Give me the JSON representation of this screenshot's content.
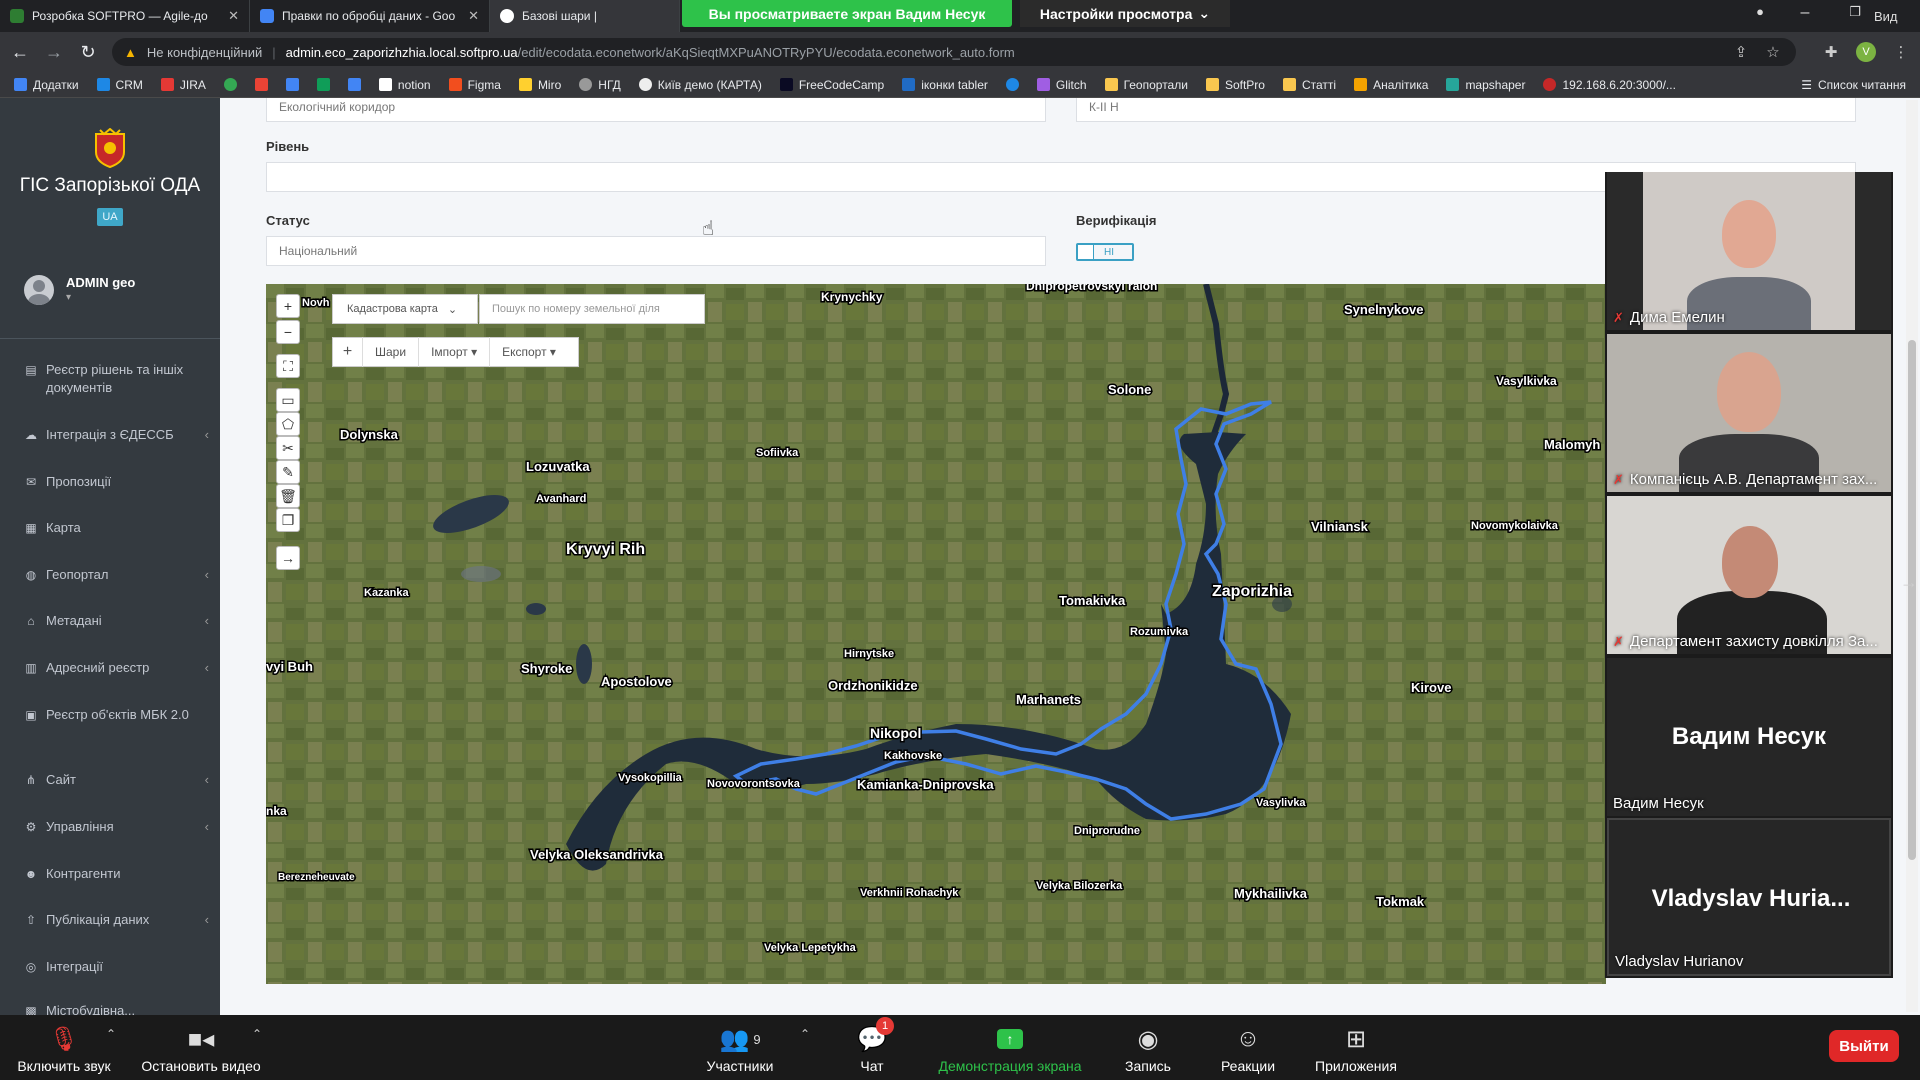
{
  "browser": {
    "tabs": [
      {
        "title": "Розробка SOFTPRO — Agile-до",
        "active": false
      },
      {
        "title": "Правки по обробці даних - Goo",
        "active": false
      },
      {
        "title": "Базові шари |",
        "active": true
      }
    ],
    "url_warning": "Не конфіденційний",
    "url_host": "admin.eco_zaporizhzhia.local.softpro.ua",
    "url_path": "/edit/ecodata.econetwork/aKqSieqtMXPuANOTRyPYU/ecodata.econetwork_auto.form",
    "window_corner_text": "Вид",
    "bookmarks": [
      "Додатки",
      "CRM",
      "JIRA",
      "notion",
      "Figma",
      "Miro",
      "НГД",
      "Київ демо (КАРТА)",
      "FreeCodeCamp",
      "іконки tabler",
      "Glitch",
      "Геопортали",
      "SoftPro",
      "Статті",
      "Аналітика",
      "mapshaper",
      "192.168.6.20:3000/..."
    ],
    "reading_list": "Список читання"
  },
  "zoom_share": {
    "banner": "Вы просматриваете экран Вадим Несук",
    "view_options": "Настройки просмотра"
  },
  "sidebar": {
    "brand": "ГІС Запорізької ОДА",
    "lang": "UA",
    "user": "ADMIN geo",
    "items": [
      {
        "label": "Реєстр рішень та іншіх документів",
        "icon": "file-icon",
        "chevron": false
      },
      {
        "label": "Інтеграція з ЄДЕССБ",
        "icon": "database-icon",
        "chevron": true
      },
      {
        "label": "Пропозиції",
        "icon": "mail-icon",
        "chevron": false
      },
      {
        "label": "Карта",
        "icon": "map-icon",
        "chevron": false
      },
      {
        "label": "Геопортал",
        "icon": "globe-icon",
        "chevron": true
      },
      {
        "label": "Метадані",
        "icon": "tag-icon",
        "chevron": true
      },
      {
        "label": "Адресний реєстр",
        "icon": "book-icon",
        "chevron": true
      },
      {
        "label": "Реєстр об'єктів МБК 2.0",
        "icon": "grid-icon",
        "chevron": false
      },
      {
        "label": "Сайт",
        "icon": "sitemap-icon",
        "chevron": true
      },
      {
        "label": "Управління",
        "icon": "settings-icon",
        "chevron": true
      },
      {
        "label": "Контрагенти",
        "icon": "users-icon",
        "chevron": false
      },
      {
        "label": "Публікація даних",
        "icon": "upload-icon",
        "chevron": true
      },
      {
        "label": "Інтеграції",
        "icon": "link-icon",
        "chevron": false
      },
      {
        "label": "Містобудівна...",
        "icon": "building-icon",
        "chevron": false
      }
    ]
  },
  "form": {
    "top_left_value": "Екологічний коридор",
    "top_right_value": "К-ІІ Н",
    "level_label": "Рівень",
    "level_value": "",
    "status_label": "Статус",
    "status_value": "Національний",
    "verification_label": "Верифікація",
    "verification_value": "НІ"
  },
  "map": {
    "layer_select": "Кадастрова карта",
    "parcel_placeholder": "Пошук по номеру земельної діля",
    "toolbar": [
      "Шари",
      "Імпорт",
      "Експорт"
    ],
    "places": [
      "Krynychky",
      "Dnipropetrovskyi raion",
      "Synelnykove",
      "Solone",
      "Vasylkivka",
      "Malomyh",
      "Dolynska",
      "Lozuvatka",
      "Avanhard",
      "Sofiivka",
      "Kryvyi Rih",
      "Kazanka",
      "Vilniansk",
      "Novomykolaivka",
      "Tomakivka",
      "Zaporizhia",
      "Rozumivka",
      "Hirnytske",
      "Shyroke",
      "Apostolove",
      "Ordzhonikidze",
      "Marhanets",
      "Kirove",
      "Nikopol",
      "Kakhovske",
      "Kamianka-Dniprovska",
      "Vysokopillia",
      "Novovorontsovka",
      "Dniprorudne",
      "Vasylivka",
      "Velyka Oleksandrivka",
      "Berezneheuvate",
      "Verkhnii Rohachyk",
      "Velyka Bilozerka",
      "Mykhailivka",
      "Tokmak",
      "Velyka Lepetykha",
      "Novh",
      "vyi Buh",
      "nka"
    ]
  },
  "video": {
    "participants": [
      {
        "name": "Дима Емелин",
        "muted": true
      },
      {
        "name": "Компанієць А.В. Департамент зах...",
        "muted": true
      },
      {
        "name": "Департамент захисту довкілля За...",
        "muted": true
      },
      {
        "name": "Вадим Несук",
        "big": "Вадим Несук",
        "muted": false
      },
      {
        "name": "Vladyslav Hurianov",
        "big": "Vladyslav  Huria...",
        "muted": false
      }
    ]
  },
  "zoom_controls": {
    "unmute": "Включить звук",
    "stop_video": "Остановить видео",
    "participants": "Участники",
    "participants_count": "9",
    "chat": "Чат",
    "chat_badge": "1",
    "share": "Демонстрация экрана",
    "record": "Запись",
    "reactions": "Реакции",
    "apps": "Приложения",
    "leave": "Выйти"
  },
  "colors": {
    "share_green": "#2ec24a",
    "leave_red": "#e02828",
    "sidebar": "#343a40",
    "accent": "#3aa0c4",
    "boundary": "#3f7fe6"
  }
}
